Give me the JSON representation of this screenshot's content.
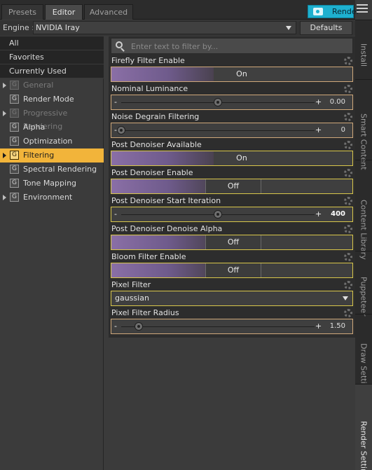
{
  "tabs": [
    {
      "label": "Presets"
    },
    {
      "label": "Editor"
    },
    {
      "label": "Advanced"
    }
  ],
  "render_button": {
    "label": "Render",
    "color": "#1eb0cf"
  },
  "engine": {
    "label": "Engine :",
    "value": "NVIDIA Iray"
  },
  "defaults_label": "Defaults",
  "sidebar": {
    "top_items": [
      {
        "label": "All"
      },
      {
        "label": "Favorites"
      },
      {
        "label": "Currently Used"
      }
    ],
    "groups": [
      {
        "label": "General",
        "icon": "G",
        "expandable": true,
        "state": "disabled"
      },
      {
        "label": "Render Mode",
        "icon": "G",
        "expandable": false,
        "state": "normal"
      },
      {
        "label": "Progressive Rendering",
        "icon": "G",
        "expandable": true,
        "state": "disabled"
      },
      {
        "label": "Alpha",
        "icon": "G",
        "expandable": false,
        "state": "normal"
      },
      {
        "label": "Optimization",
        "icon": "G",
        "expandable": false,
        "state": "normal"
      },
      {
        "label": "Filtering",
        "icon": "G",
        "expandable": true,
        "state": "selected"
      },
      {
        "label": "Spectral Rendering",
        "icon": "G",
        "expandable": false,
        "state": "normal"
      },
      {
        "label": "Tone Mapping",
        "icon": "G",
        "expandable": false,
        "state": "normal"
      },
      {
        "label": "Environment",
        "icon": "G",
        "expandable": true,
        "state": "normal"
      }
    ],
    "selected_color": "#f2b43a"
  },
  "filter": {
    "placeholder": "Enter text to filter by..."
  },
  "properties": [
    {
      "label": "Firefly Filter Enable",
      "type": "toggle",
      "value": "On"
    },
    {
      "label": "Nominal Luminance",
      "type": "slider",
      "value": "0.00",
      "fraction": 0.5
    },
    {
      "label": "Noise Degrain Filtering",
      "type": "slider",
      "value": "0",
      "fraction": 0.0
    },
    {
      "label": "Post Denoiser Available",
      "type": "toggle",
      "value": "On"
    },
    {
      "label": "Post Denoiser Enable",
      "type": "toggle",
      "value": "Off"
    },
    {
      "label": "Post Denoiser Start Iteration",
      "type": "slider",
      "value": "400",
      "fraction": 0.5
    },
    {
      "label": "Post Denoiser Denoise Alpha",
      "type": "toggle",
      "value": "Off"
    },
    {
      "label": "Bloom Filter Enable",
      "type": "toggle",
      "value": "Off"
    },
    {
      "label": "Pixel Filter",
      "type": "select",
      "value": "gaussian"
    },
    {
      "label": "Pixel Filter Radius",
      "type": "slider",
      "value": "1.50",
      "fraction": 0.09
    }
  ],
  "right_tabs": [
    {
      "label": "Install"
    },
    {
      "label": "Smart Content"
    },
    {
      "label": "Content Library"
    },
    {
      "label": "Puppeteer"
    },
    {
      "label": "Draw Settings"
    },
    {
      "label": "Render Settings"
    }
  ]
}
